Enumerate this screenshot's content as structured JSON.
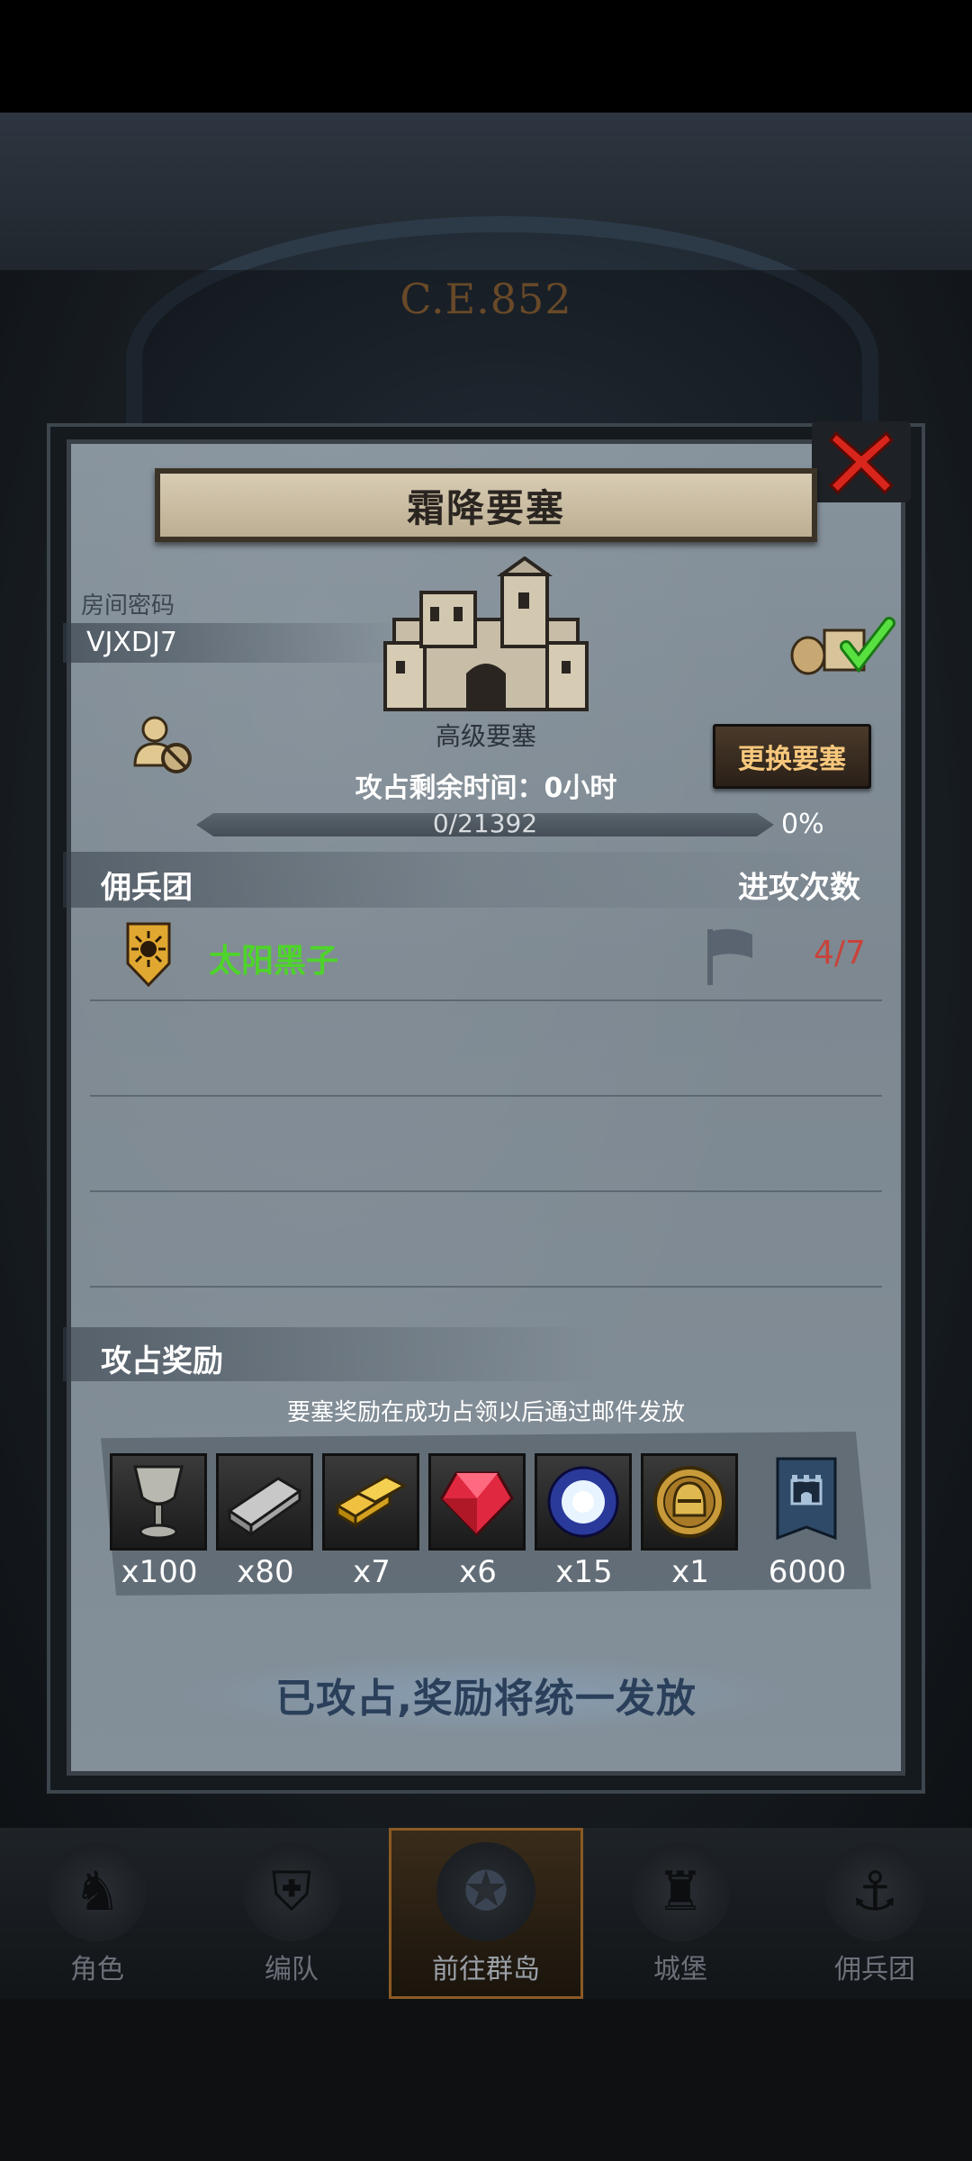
{
  "background": {
    "era": "C.E.852"
  },
  "modal": {
    "title": "霜降要塞",
    "close_icon": "close-x-icon",
    "room": {
      "label": "房间密码",
      "code": "VJXDJ7"
    },
    "fortress": {
      "level": "高级要塞",
      "remaining_time": "攻占剩余时间：0小时",
      "progress_text": "0/21392",
      "progress_percent": "0%",
      "progress_value": 0
    },
    "change_button": "更换要塞",
    "mercenary_section": {
      "title": "佣兵团",
      "attack_count_title": "进攻次数",
      "rows": [
        {
          "name": "太阳黑子",
          "attack_count": "4/7",
          "name_color": "#4ed42a"
        }
      ]
    },
    "rewards": {
      "title": "攻占奖励",
      "note": "要塞奖励在成功占领以后通过邮件发放",
      "items": [
        {
          "icon": "goblet-icon",
          "qty": "x100"
        },
        {
          "icon": "iron-ingot-icon",
          "qty": "x80"
        },
        {
          "icon": "gold-bar-icon",
          "qty": "x7"
        },
        {
          "icon": "ruby-icon",
          "qty": "x6"
        },
        {
          "icon": "crystal-icon",
          "qty": "x15"
        },
        {
          "icon": "helmet-coin-icon",
          "qty": "x1"
        },
        {
          "icon": "fortress-banner-icon",
          "qty": "6000"
        }
      ]
    },
    "claim_status": "已攻占,奖励将统一发放"
  },
  "bottom_nav": [
    {
      "label": "角色",
      "icon": "knight-icon"
    },
    {
      "label": "编队",
      "icon": "armor-icon"
    },
    {
      "label": "前往群岛",
      "icon": "compass-icon",
      "active": true
    },
    {
      "label": "城堡",
      "icon": "castle-icon"
    },
    {
      "label": "佣兵团",
      "icon": "ship-icon"
    }
  ]
}
